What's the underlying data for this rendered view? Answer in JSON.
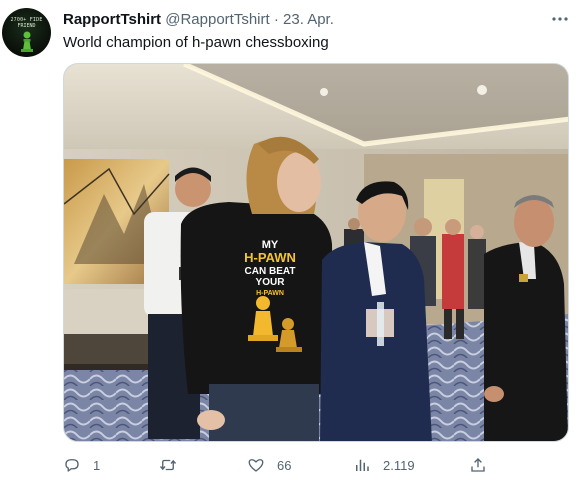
{
  "tweet": {
    "author_name": "RapportTshirt",
    "handle": "@RapportTshirt",
    "separator": "·",
    "date": "23. Apr.",
    "more_label": "···",
    "text": "World champion of h-pawn chessboxing",
    "avatar_text_top": "2700+ FIDE",
    "avatar_text_bottom": "FRIEND",
    "media": {
      "shirt_line1": "MY",
      "shirt_line2": "H-PAWN",
      "shirt_line3": "CAN BEAT",
      "shirt_line4": "YOUR",
      "shirt_line5": "H-PAWN"
    },
    "actions": {
      "replies": "1",
      "retweets": "",
      "likes": "66",
      "views": "2.119"
    }
  },
  "colors": {
    "text_primary": "#0f1419",
    "text_secondary": "#536471",
    "border": "#cfd9de"
  },
  "icons": [
    "reply-icon",
    "retweet-icon",
    "like-icon",
    "views-icon",
    "share-icon",
    "more-icon"
  ]
}
